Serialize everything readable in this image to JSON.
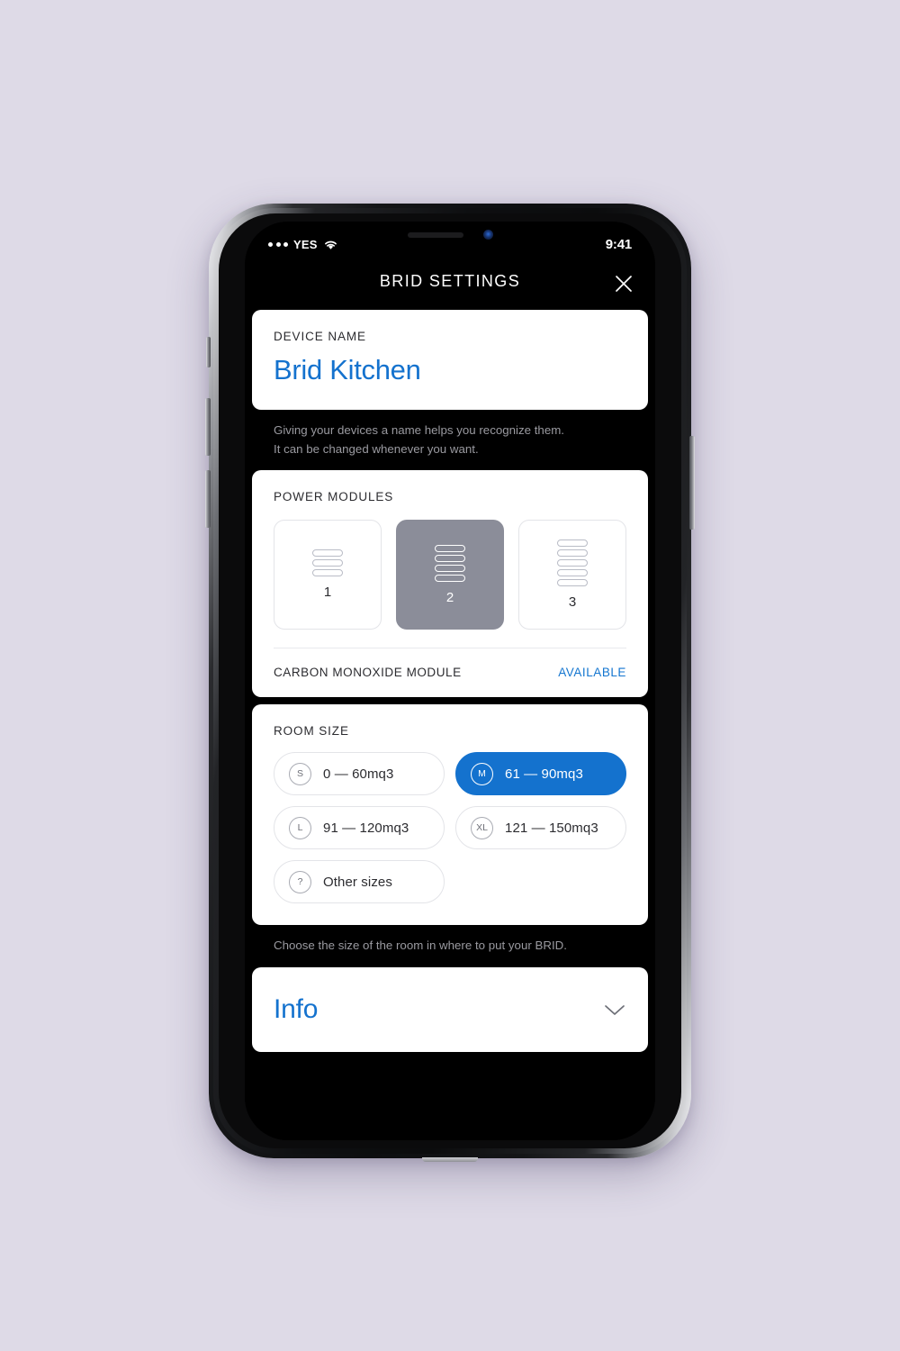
{
  "background_color": "#dedae7",
  "accent_blue": "#1472ce",
  "selected_module_gray": "#8b8d99",
  "status_bar": {
    "signal_icon": "signal-dots-icon",
    "carrier": "YES",
    "wifi_icon": "wifi-icon",
    "time": "9:41"
  },
  "navbar": {
    "title": "BRID SETTINGS",
    "close_icon": "close-icon"
  },
  "device_name_card": {
    "label": "DEVICE NAME",
    "value": "Brid Kitchen",
    "placeholder": "Device name"
  },
  "device_name_helper": "Giving your devices a name helps you recognize them.\nIt can be changed whenever you want.",
  "device_name_helper_line1": "Giving your devices a name helps you recognize them.",
  "device_name_helper_line2": "It can be changed whenever you want.",
  "power_modules_card": {
    "label": "POWER MODULES",
    "modules": [
      {
        "number": "1",
        "bars": 3,
        "selected": false,
        "icon": "stacked-bars-icon"
      },
      {
        "number": "2",
        "bars": 4,
        "selected": true,
        "icon": "stacked-bars-icon"
      },
      {
        "number": "3",
        "bars": 5,
        "selected": false,
        "icon": "stacked-bars-icon"
      }
    ],
    "carbon_monoxide_label": "CARBON MONOXIDE MODULE",
    "carbon_monoxide_status": "AVAILABLE"
  },
  "room_size_card": {
    "label": "ROOM SIZE",
    "options": [
      {
        "badge": "S",
        "text": "0 — 60mq3",
        "selected": false
      },
      {
        "badge": "M",
        "text": "61 — 90mq3",
        "selected": true
      },
      {
        "badge": "L",
        "text": "91 — 120mq3",
        "selected": false
      },
      {
        "badge": "XL",
        "text": "121 — 150mq3",
        "selected": false
      },
      {
        "badge": "?",
        "text": "Other sizes",
        "selected": false
      }
    ]
  },
  "room_size_helper": "Choose the size of the room in where to put your BRID.",
  "info_card": {
    "title": "Info",
    "chevron_icon": "chevron-down-icon"
  }
}
